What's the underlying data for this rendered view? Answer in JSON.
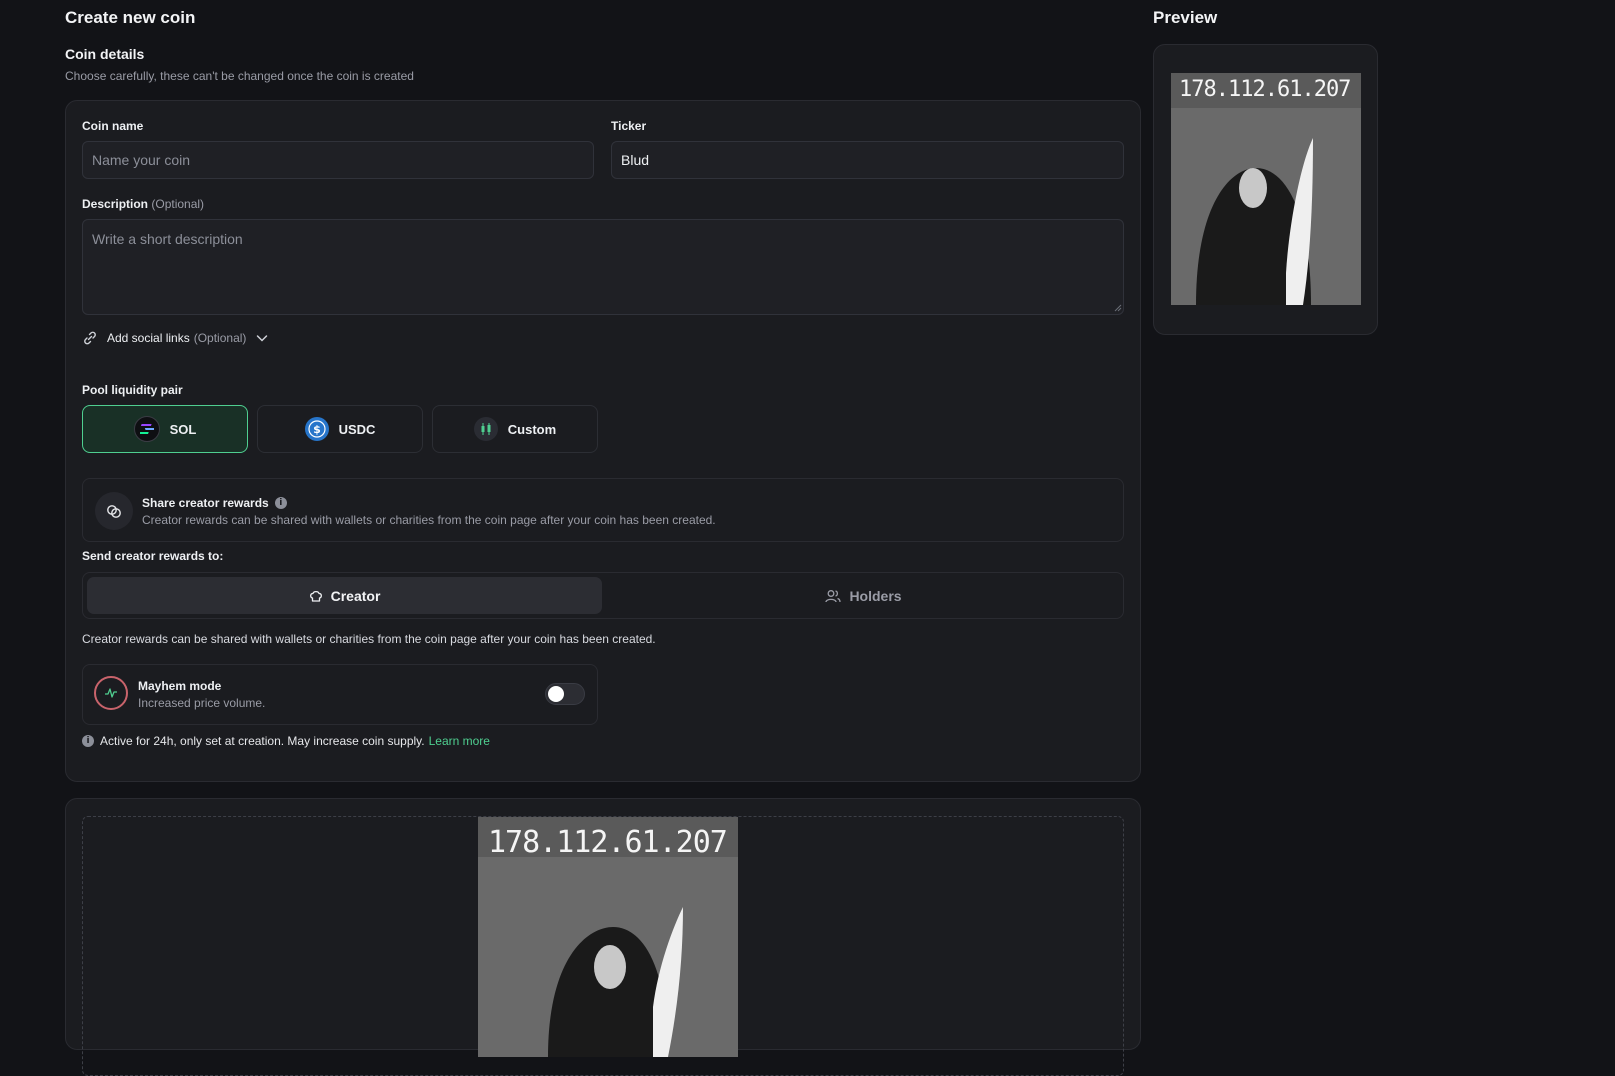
{
  "page": {
    "title": "Create new coin",
    "preview_title": "Preview"
  },
  "details": {
    "title": "Coin details",
    "subtitle": "Choose carefully, these can't be changed once the coin is created"
  },
  "form": {
    "coin_name_label": "Coin name",
    "coin_name_placeholder": "Name your coin",
    "ticker_label": "Ticker",
    "ticker_value": "Blud",
    "description_label": "Description",
    "description_optional": "(Optional)",
    "description_placeholder": "Write a short description",
    "social_label": "Add social links",
    "social_optional": "(Optional)"
  },
  "pool": {
    "label": "Pool liquidity pair",
    "options": [
      {
        "label": "SOL",
        "icon": "sol-icon",
        "selected": true
      },
      {
        "label": "USDC",
        "icon": "usdc-icon",
        "selected": false
      },
      {
        "label": "Custom",
        "icon": "candles-icon",
        "selected": false
      }
    ]
  },
  "share": {
    "title": "Share creator rewards",
    "desc": "Creator rewards can be shared with wallets or charities from the coin page after your coin has been created."
  },
  "rewards": {
    "label": "Send creator rewards to:",
    "creator": "Creator",
    "holders": "Holders",
    "selected": "Creator",
    "note": "Creator rewards can be shared with wallets or charities from the coin page after your coin has been created."
  },
  "mayhem": {
    "title": "Mayhem mode",
    "desc": "Increased price volume.",
    "enabled": false,
    "info": "Active for 24h, only set at creation. May increase coin supply.",
    "learn_more": "Learn more"
  },
  "image": {
    "overlay_text": "178.112.61.207"
  },
  "colors": {
    "accent": "#4fcf90",
    "background": "#121317",
    "card": "#1b1c20",
    "usdc": "#2775ca"
  }
}
